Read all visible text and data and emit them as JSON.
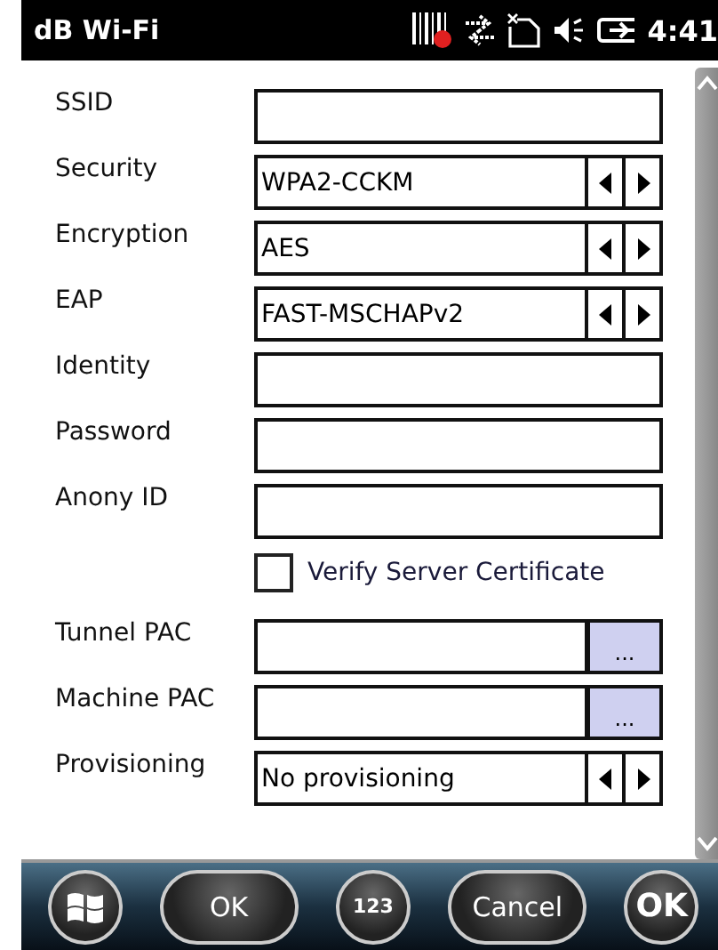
{
  "title_bar": {
    "title": "dB Wi-Fi",
    "time": "4:41"
  },
  "fields": [
    {
      "kind": "text",
      "label": "SSID"
    },
    {
      "kind": "spinner",
      "label": "Security",
      "value": "WPA2-CCKM"
    },
    {
      "kind": "spinner",
      "label": "Encryption",
      "value": "AES"
    },
    {
      "kind": "spinner",
      "label": "EAP",
      "value": "FAST-MSCHAPv2"
    },
    {
      "kind": "text",
      "label": "Identity"
    },
    {
      "kind": "text",
      "label": "Password"
    },
    {
      "kind": "text",
      "label": "Anony ID"
    },
    {
      "kind": "checkbox",
      "label": "Verify Server Certificate",
      "checked": false
    },
    {
      "kind": "browse",
      "label": "Tunnel PAC",
      "button": "..."
    },
    {
      "kind": "browse",
      "label": "Machine PAC",
      "button": "..."
    },
    {
      "kind": "spinner",
      "label": "Provisioning",
      "value": "No provisioning"
    }
  ],
  "softkeys": [
    {
      "kind": "start"
    },
    {
      "kind": "button",
      "label": "OK"
    },
    {
      "kind": "button",
      "label": "123"
    },
    {
      "kind": "button",
      "label": "Cancel"
    },
    {
      "kind": "ok",
      "label": "OK"
    }
  ]
}
